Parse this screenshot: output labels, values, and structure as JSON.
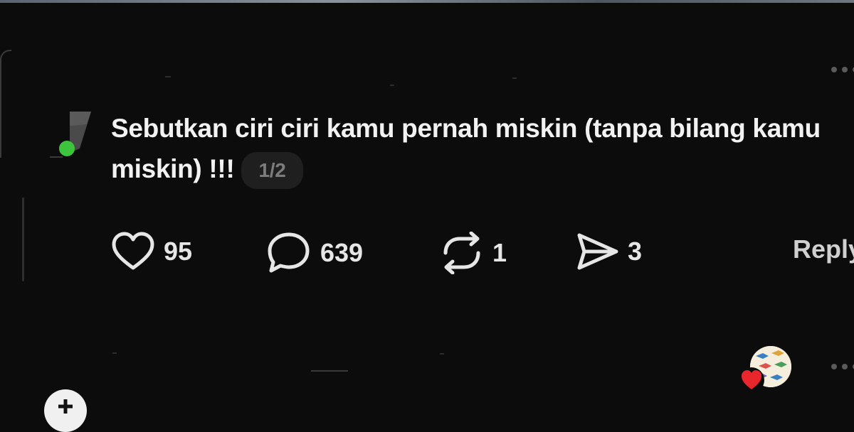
{
  "post": {
    "text": "Sebutkan ciri ciri kamu pernah miskin (tanpa bilang kamu miskin) !!!",
    "page_indicator": "1/2"
  },
  "actions": {
    "likes": "95",
    "comments": "639",
    "reposts": "1",
    "shares": "3",
    "reply_label": "Reply"
  },
  "icons": {
    "like": "heart-icon",
    "comment": "comment-bubble-icon",
    "repost": "repost-icon",
    "share": "send-icon",
    "more": "more-dots-icon"
  },
  "colors": {
    "background": "#0c0c0c",
    "text": "#f2f2f2",
    "muted": "#7c7c7c",
    "heart_badge": "#e8262c",
    "online_dot": "#3cc43c"
  }
}
